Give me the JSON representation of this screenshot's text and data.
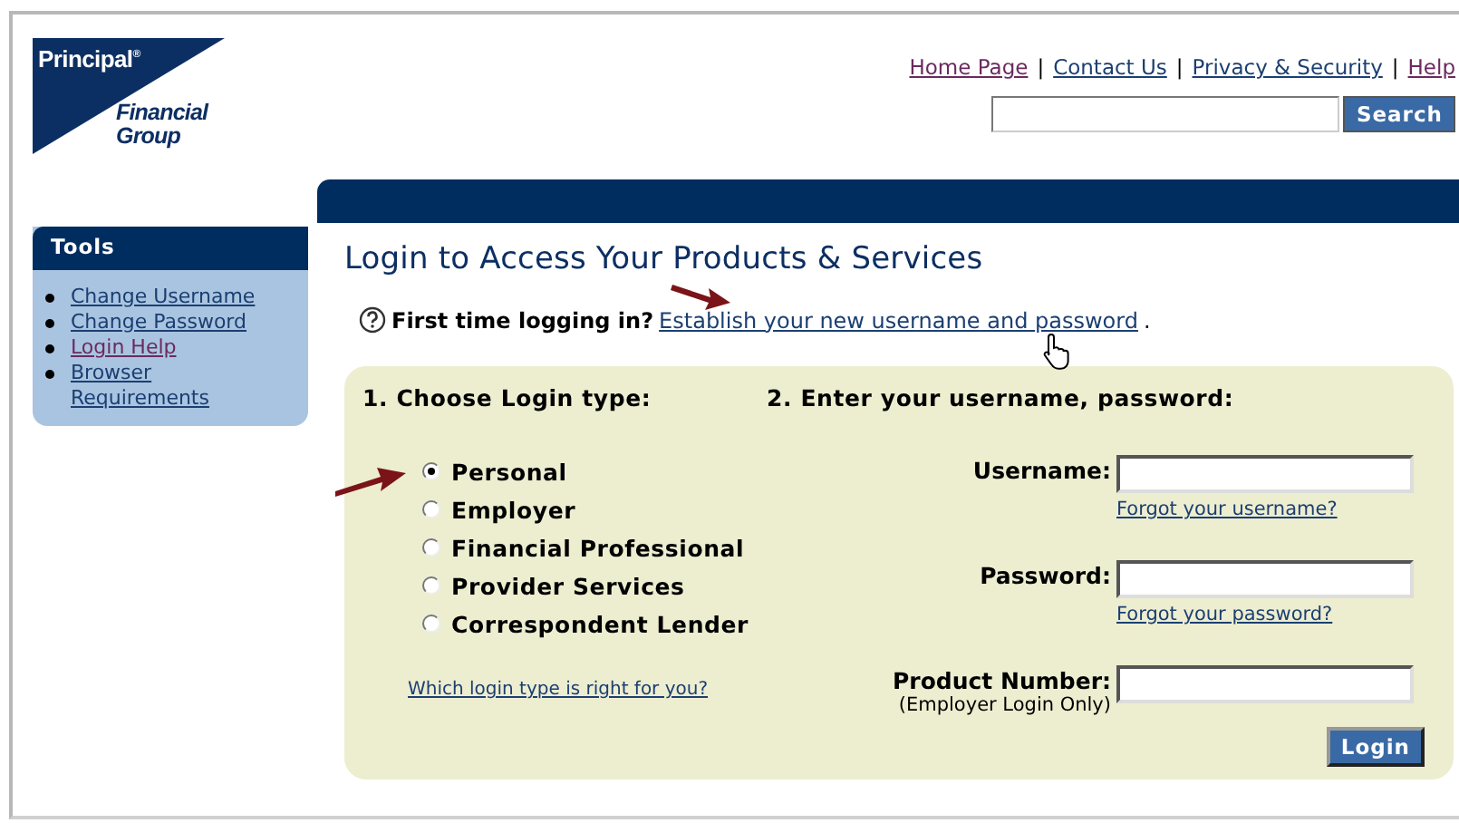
{
  "logo": {
    "name": "Principal$^{®}$",
    "tagline": [
      "Financial",
      "Group"
    ]
  },
  "top_links": {
    "separator": "|",
    "items": [
      {
        "label": "Home Page",
        "visited": true
      },
      {
        "label": "Contact Us",
        "visited": false
      },
      {
        "label": "Privacy & Security",
        "visited": false
      },
      {
        "label": "Help",
        "visited": true
      }
    ]
  },
  "search": {
    "button": "Search"
  },
  "sidebar": {
    "title": "Tools",
    "items": [
      {
        "label": "Change Username",
        "visited": false
      },
      {
        "label": "Change Password",
        "visited": false
      },
      {
        "label": "Login Help",
        "visited": true
      },
      {
        "label": "Browser Requirements",
        "visited": false
      }
    ]
  },
  "heading": "Login to Access Your Products & Services",
  "first_time": {
    "question": "First time logging in?",
    "link": "Establish your new username and password",
    "end": "."
  },
  "login_type": {
    "title": "1. Choose Login type:",
    "options": [
      {
        "label": "Personal",
        "selected": true
      },
      {
        "label": "Employer",
        "selected": false
      },
      {
        "label": "Financial Professional",
        "selected": false
      },
      {
        "label": "Provider Services",
        "selected": false
      },
      {
        "label": "Correspondent Lender",
        "selected": false
      }
    ],
    "help_link": "Which login type is right for you?"
  },
  "credentials": {
    "title": "2. Enter your username, password:",
    "fields": [
      {
        "label": "Username:",
        "link": "Forgot your username?"
      },
      {
        "label": "Password:",
        "link": "Forgot your password?"
      },
      {
        "label": "Product Number:",
        "note": "(Employer Login Only)"
      }
    ],
    "button": "Login"
  }
}
